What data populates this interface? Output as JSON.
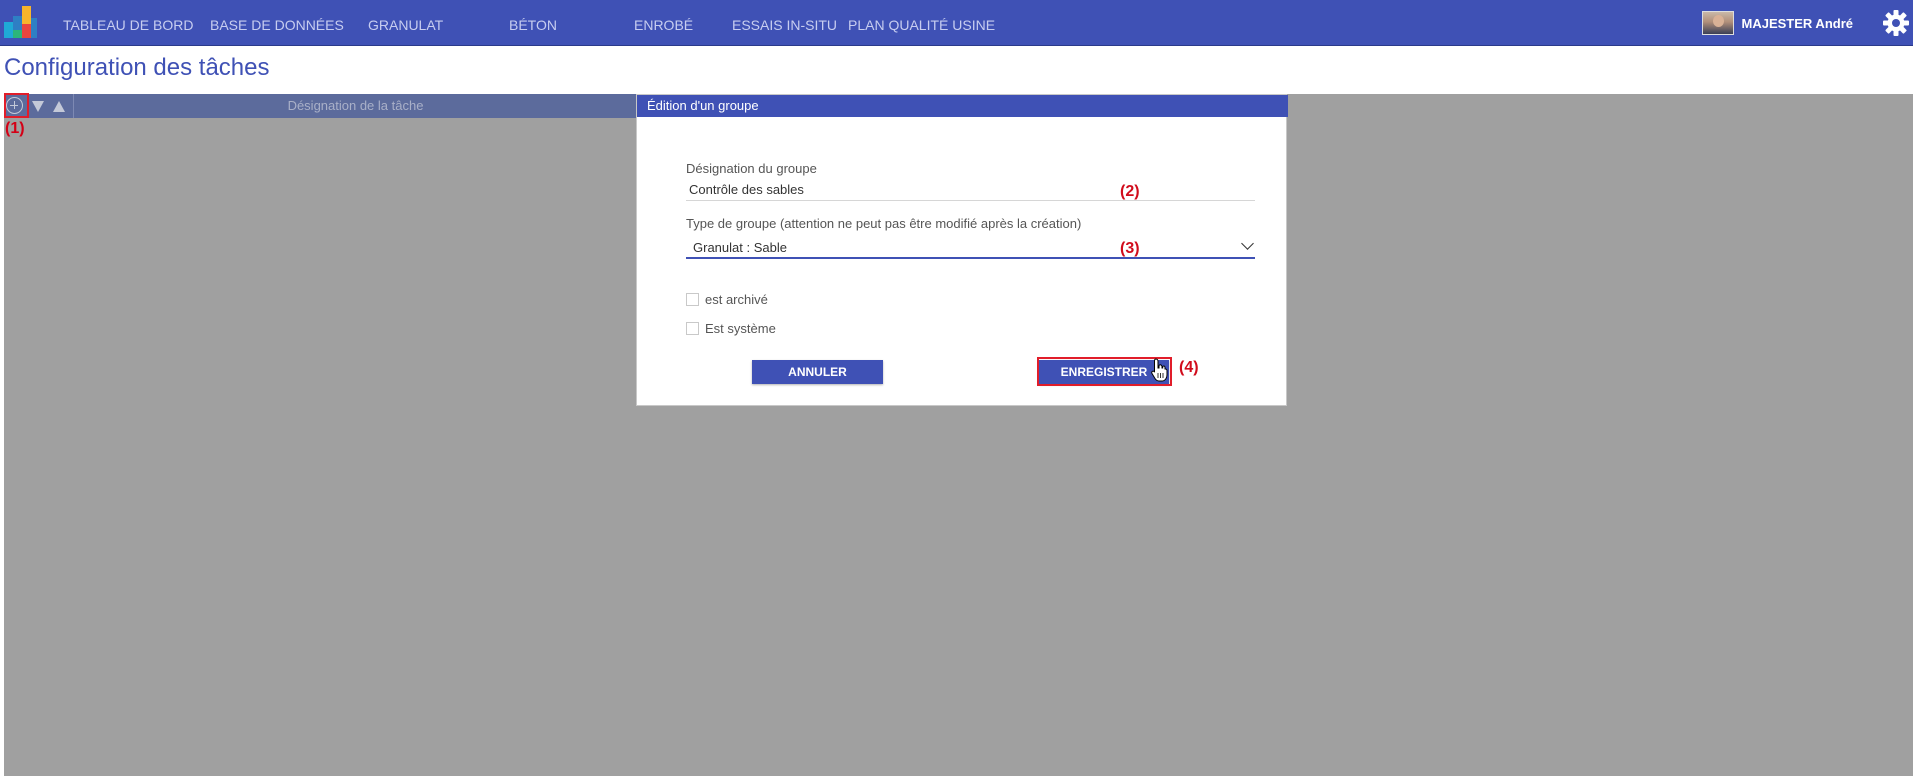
{
  "topnav": {
    "items": [
      {
        "label": "TABLEAU DE BORD"
      },
      {
        "label": "BASE DE DONNÉES"
      },
      {
        "label": "GRANULAT"
      },
      {
        "label": "BÉTON"
      },
      {
        "label": "ENROBÉ"
      },
      {
        "label": "ESSAIS IN-SITU"
      },
      {
        "label": "PLAN QUALITÉ USINE"
      }
    ],
    "user_name": "MAJESTER André"
  },
  "page": {
    "title": "Configuration des tâches"
  },
  "grid": {
    "column_header": "Désignation de la tâche"
  },
  "dialog": {
    "title": "Édition d'un groupe",
    "designation_label": "Désignation du groupe",
    "designation_value": "Contrôle des sables",
    "type_label": "Type de groupe (attention ne peut pas être modifié après la création)",
    "type_value": "Granulat : Sable",
    "archived_label": "est archivé",
    "system_label": "Est système",
    "cancel_label": "ANNULER",
    "save_label": "ENREGISTRER"
  },
  "annotations": {
    "mark1": "(1)",
    "mark2": "(2)",
    "mark3": "(3)",
    "mark4": "(4)"
  },
  "colors": {
    "primary": "#3f51b5",
    "overlay": "#a0a0a0",
    "grid_header": "#5c6b9c",
    "annotation": "#e11d2a"
  }
}
